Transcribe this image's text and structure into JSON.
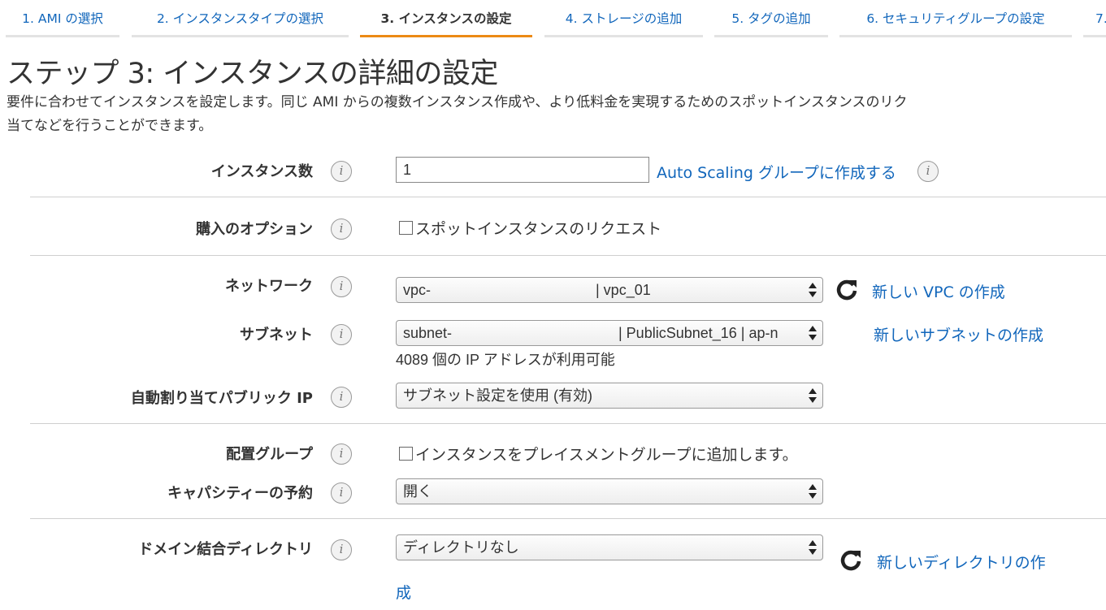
{
  "tabs": [
    {
      "label": "1. AMI の選択",
      "active": false
    },
    {
      "label": "2. インスタンスタイプの選択",
      "active": false
    },
    {
      "label": "3. インスタンスの設定",
      "active": true
    },
    {
      "label": "4. ストレージの追加",
      "active": false
    },
    {
      "label": "5. タグの追加",
      "active": false
    },
    {
      "label": "6. セキュリティグループの設定",
      "active": false
    },
    {
      "label": "7.",
      "active": false
    }
  ],
  "page_title": "ステップ 3: インスタンスの詳細の設定",
  "description": "要件に合わせてインスタンスを設定します。同じ AMI からの複数インスタンス作成や、より低料金を実現するためのスポットインスタンスのリクエスト、インスタンスへの管理ロールの割り当てなどを行うことができます。",
  "description_line1": "要件に合わせてインスタンスを設定します。同じ AMI からの複数インスタンス作成や、より低料金を実現するためのスポットインスタンスのリク",
  "description_line2": "当てなどを行うことができます。",
  "info_glyph": "i",
  "fields": {
    "instance_count": {
      "label": "インスタンス数",
      "value": "1",
      "link": "Auto Scaling グループに作成する"
    },
    "purchase_option": {
      "label": "購入のオプション",
      "checkbox_label": "スポットインスタンスのリクエスト",
      "checked": false
    },
    "network": {
      "label": "ネットワーク",
      "value_prefix": "vpc-",
      "value_suffix": "| vpc_01",
      "link": "新しい VPC の作成"
    },
    "subnet": {
      "label": "サブネット",
      "value_prefix": "subnet-",
      "value_suffix": "| PublicSubnet_16 | ap-n",
      "note": "4089 個の IP アドレスが利用可能",
      "link": "新しいサブネットの作成"
    },
    "public_ip": {
      "label": "自動割り当てパブリック IP",
      "value": "サブネット設定を使用 (有効)"
    },
    "placement_group": {
      "label": "配置グループ",
      "checkbox_label": "インスタンスをプレイスメントグループに追加します。",
      "checked": false
    },
    "capacity_reservation": {
      "label": "キャパシティーの予約",
      "value": "開く"
    },
    "domain_directory": {
      "label": "ドメイン結合ディレクトリ",
      "value": "ディレクトリなし",
      "link_line1": "新しいディレクトリの作",
      "link_line2": "成"
    }
  },
  "colors": {
    "link": "#1166bb",
    "active_tab_underline": "#ec8a15",
    "text": "#333333"
  }
}
